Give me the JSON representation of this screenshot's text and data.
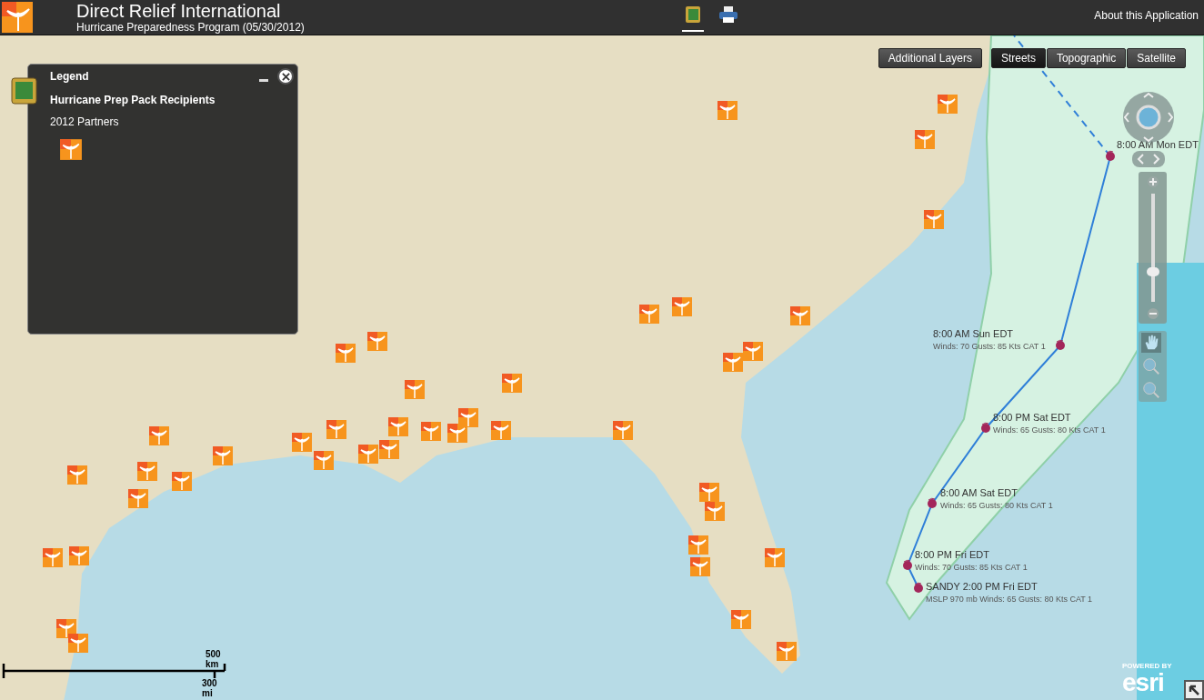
{
  "header": {
    "title": "Direct Relief International",
    "subtitle": "Hurricane Preparedness Program (05/30/2012)",
    "about_link": "About this Application"
  },
  "legend": {
    "title": "Legend",
    "layer": "Hurricane Prep Pack Recipients",
    "category": "2012 Partners"
  },
  "additional_layers_button": "Additional Layers",
  "basemaps": [
    {
      "label": "Streets",
      "selected": true
    },
    {
      "label": "Topographic",
      "selected": false
    },
    {
      "label": "Satellite",
      "selected": false
    }
  ],
  "zoom_slider": {
    "level": 0.28
  },
  "hurricane_track": [
    {
      "time": "8:00 AM Mon EDT"
    },
    {
      "time": "8:00 AM Sun EDT",
      "details": "Winds: 70 Gusts: 85 Kts CAT 1"
    },
    {
      "time": "8:00 PM Sat EDT",
      "details": "Winds: 65 Gusts: 80 Kts CAT 1"
    },
    {
      "time": "8:00 AM Sat EDT",
      "details": "Winds: 65 Gusts: 80 Kts CAT 1"
    },
    {
      "time": "8:00 PM Fri EDT",
      "details": "Winds: 70 Gusts: 85 Kts CAT 1"
    },
    {
      "time": "SANDY 2:00 PM Fri EDT",
      "details": "MSLP 970 mb Winds: 65 Gusts: 80 Kts CAT 1"
    }
  ],
  "scale_bar": {
    "metric": "500 km",
    "imperial": "300 mi"
  },
  "attribution": {
    "powered_by": "POWERED BY",
    "brand": "esri"
  }
}
